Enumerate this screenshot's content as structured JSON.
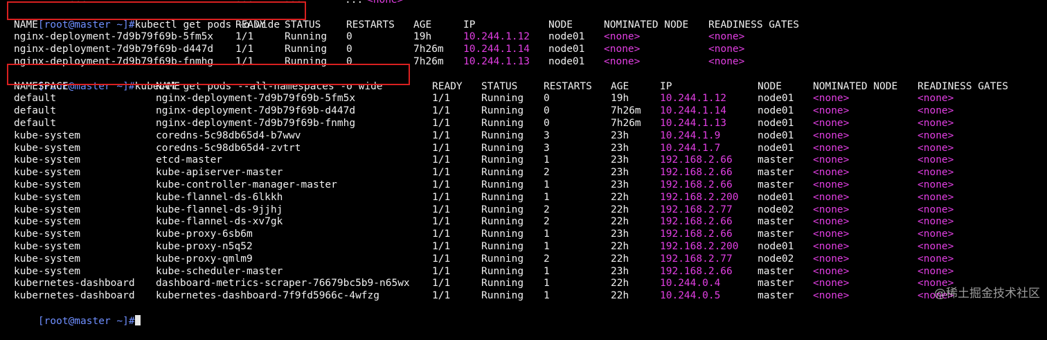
{
  "cut_line": {
    "cols": [
      "...",
      "...",
      "...",
      "...",
      "<none>"
    ]
  },
  "cmd1": {
    "prompt": "[root@master ~]#",
    "command": "kubectl get pods -o wide"
  },
  "table1": {
    "headers": [
      "NAME",
      "READY",
      "STATUS",
      "RESTARTS",
      "AGE",
      "IP",
      "NODE",
      "NOMINATED NODE",
      "READINESS GATES"
    ],
    "rows": [
      [
        "nginx-deployment-7d9b79f69b-5fm5x",
        "1/1",
        "Running",
        "0",
        "19h",
        "10.244.1.12",
        "node01",
        "<none>",
        "<none>"
      ],
      [
        "nginx-deployment-7d9b79f69b-d447d",
        "1/1",
        "Running",
        "0",
        "7h26m",
        "10.244.1.14",
        "node01",
        "<none>",
        "<none>"
      ],
      [
        "nginx-deployment-7d9b79f69b-fnmhg",
        "1/1",
        "Running",
        "0",
        "7h26m",
        "10.244.1.13",
        "node01",
        "<none>",
        "<none>"
      ]
    ]
  },
  "cmd2": {
    "prompt": "[root@master ~]#",
    "command": "kubectl get pods --all-namespaces -o wide"
  },
  "table2": {
    "headers": [
      "NAMESPACE",
      "NAME",
      "READY",
      "STATUS",
      "RESTARTS",
      "AGE",
      "IP",
      "NODE",
      "NOMINATED NODE",
      "READINESS GATES"
    ],
    "rows": [
      [
        "default",
        "nginx-deployment-7d9b79f69b-5fm5x",
        "1/1",
        "Running",
        "0",
        "19h",
        "10.244.1.12",
        "node01",
        "<none>",
        "<none>"
      ],
      [
        "default",
        "nginx-deployment-7d9b79f69b-d447d",
        "1/1",
        "Running",
        "0",
        "7h26m",
        "10.244.1.14",
        "node01",
        "<none>",
        "<none>"
      ],
      [
        "default",
        "nginx-deployment-7d9b79f69b-fnmhg",
        "1/1",
        "Running",
        "0",
        "7h26m",
        "10.244.1.13",
        "node01",
        "<none>",
        "<none>"
      ],
      [
        "kube-system",
        "coredns-5c98db65d4-b7wwv",
        "1/1",
        "Running",
        "3",
        "23h",
        "10.244.1.9",
        "node01",
        "<none>",
        "<none>"
      ],
      [
        "kube-system",
        "coredns-5c98db65d4-zvtrt",
        "1/1",
        "Running",
        "3",
        "23h",
        "10.244.1.7",
        "node01",
        "<none>",
        "<none>"
      ],
      [
        "kube-system",
        "etcd-master",
        "1/1",
        "Running",
        "1",
        "23h",
        "192.168.2.66",
        "master",
        "<none>",
        "<none>"
      ],
      [
        "kube-system",
        "kube-apiserver-master",
        "1/1",
        "Running",
        "2",
        "23h",
        "192.168.2.66",
        "master",
        "<none>",
        "<none>"
      ],
      [
        "kube-system",
        "kube-controller-manager-master",
        "1/1",
        "Running",
        "1",
        "23h",
        "192.168.2.66",
        "master",
        "<none>",
        "<none>"
      ],
      [
        "kube-system",
        "kube-flannel-ds-6lkkh",
        "1/1",
        "Running",
        "1",
        "22h",
        "192.168.2.200",
        "node01",
        "<none>",
        "<none>"
      ],
      [
        "kube-system",
        "kube-flannel-ds-9jjhj",
        "1/1",
        "Running",
        "2",
        "22h",
        "192.168.2.77",
        "node02",
        "<none>",
        "<none>"
      ],
      [
        "kube-system",
        "kube-flannel-ds-xv7gk",
        "1/1",
        "Running",
        "2",
        "22h",
        "192.168.2.66",
        "master",
        "<none>",
        "<none>"
      ],
      [
        "kube-system",
        "kube-proxy-6sb6m",
        "1/1",
        "Running",
        "1",
        "23h",
        "192.168.2.66",
        "master",
        "<none>",
        "<none>"
      ],
      [
        "kube-system",
        "kube-proxy-n5q52",
        "1/1",
        "Running",
        "1",
        "22h",
        "192.168.2.200",
        "node01",
        "<none>",
        "<none>"
      ],
      [
        "kube-system",
        "kube-proxy-qmlm9",
        "1/1",
        "Running",
        "2",
        "22h",
        "192.168.2.77",
        "node02",
        "<none>",
        "<none>"
      ],
      [
        "kube-system",
        "kube-scheduler-master",
        "1/1",
        "Running",
        "1",
        "23h",
        "192.168.2.66",
        "master",
        "<none>",
        "<none>"
      ],
      [
        "kubernetes-dashboard",
        "dashboard-metrics-scraper-76679bc5b9-n65wx",
        "1/1",
        "Running",
        "1",
        "22h",
        "10.244.0.4",
        "master",
        "<none>",
        "<none>"
      ],
      [
        "kubernetes-dashboard",
        "kubernetes-dashboard-7f9fd5966c-4wfzg",
        "1/1",
        "Running",
        "1",
        "22h",
        "10.244.0.5",
        "master",
        "<none>",
        "<none>"
      ]
    ]
  },
  "final_prompt": "[root@master ~]#",
  "watermark": "@稀土掘金技术社区",
  "colors": {
    "background": "#000000",
    "text": "#f0f0f0",
    "prompt": "#6f8fff",
    "ip_and_none": "#e23fe3",
    "highlight_box": "#d92020"
  }
}
